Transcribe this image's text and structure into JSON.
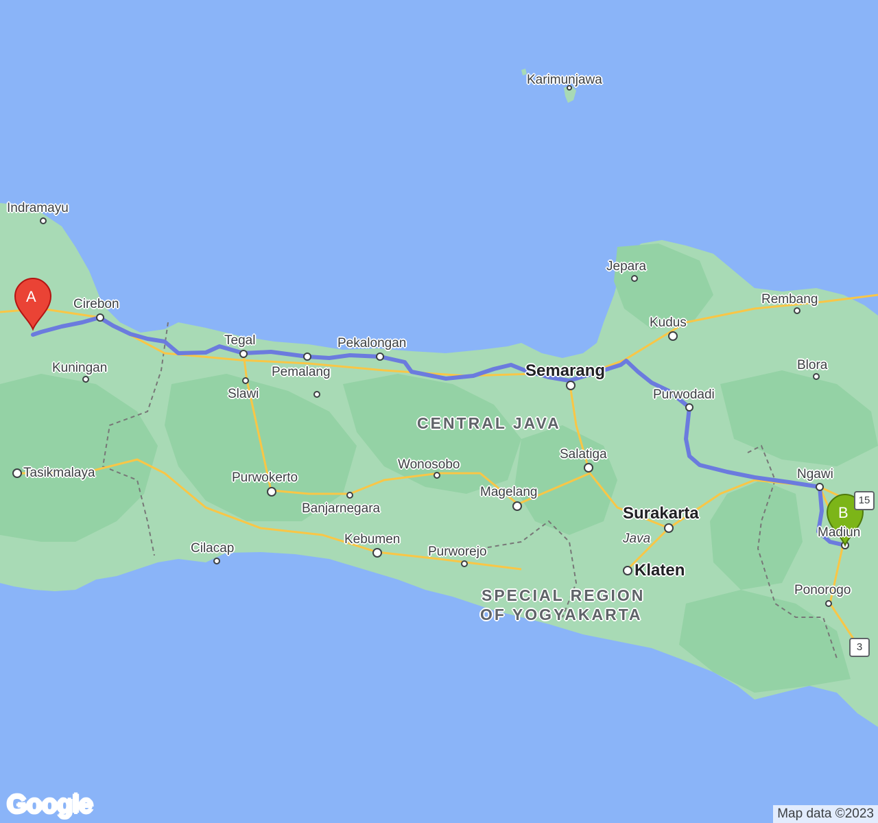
{
  "colors": {
    "sea": "#8ab4f8",
    "land": "#a8dab5",
    "forest": "#94d2a5",
    "route": "#6b7bde",
    "marker_a": "#ea4335",
    "marker_b": "#7cb518"
  },
  "markers": {
    "start_label": "A",
    "end_label": "B"
  },
  "labels": {
    "indramayu": "Indramayu",
    "cirebon": "Cirebon",
    "kuningan": "Kuningan",
    "tegal": "Tegal",
    "pemalang": "Pemalang",
    "slawi": "Slawi",
    "pekalongan": "Pekalongan",
    "semarang": "Semarang",
    "jepara": "Jepara",
    "kudus": "Kudus",
    "rembang": "Rembang",
    "blora": "Blora",
    "purwodadi": "Purwodadi",
    "salatiga": "Salatiga",
    "ngawi": "Ngawi",
    "madiun": "Madiun",
    "surakarta": "Surakarta",
    "java": "Java",
    "klaten": "Klaten",
    "ponorogo": "Ponorogo",
    "karimunjawa": "Karimunjawa",
    "tasikmalaya": "Tasikmalaya",
    "purwokerto": "Purwokerto",
    "banjarnegara": "Banjarnegara",
    "wonosobo": "Wonosobo",
    "magelang": "Magelang",
    "kebumen": "Kebumen",
    "purworejo": "Purworejo",
    "cilacap": "Cilacap",
    "central_java": "CENTRAL JAVA",
    "diy_line1": "SPECIAL REGION",
    "diy_line2": "OF YOGYAKARTA"
  },
  "shields": {
    "road_15": "15",
    "road_3": "3"
  },
  "footer": {
    "logo": "Google",
    "attribution": "Map data ©2023"
  }
}
